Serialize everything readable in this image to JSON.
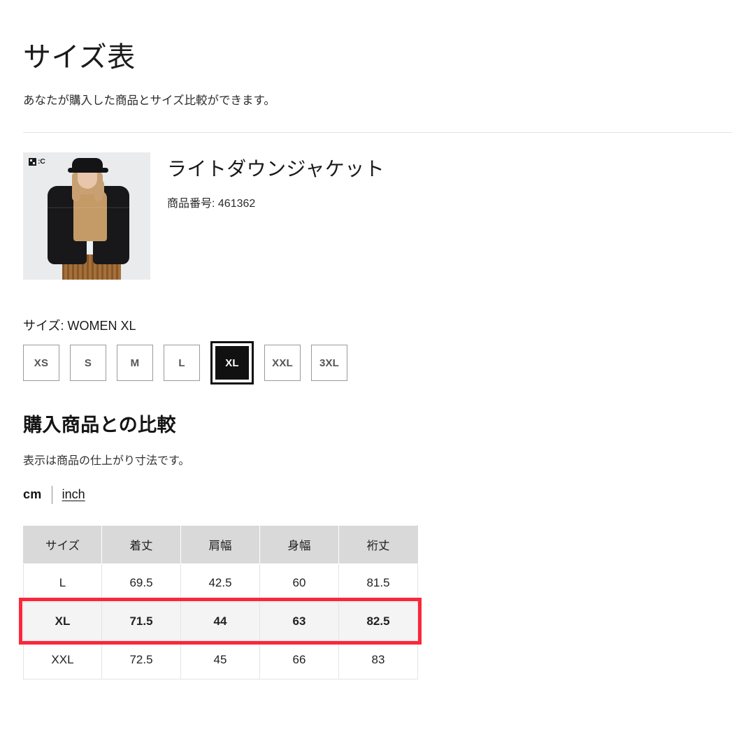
{
  "header": {
    "title": "サイズ表",
    "subtitle": "あなたが購入した商品とサイズ比較ができます。"
  },
  "product": {
    "badge_text": ":C",
    "name": "ライトダウンジャケット",
    "code_label": "商品番号: 461362"
  },
  "size_selector": {
    "label": "サイズ: WOMEN XL",
    "selected": "XL",
    "options": [
      {
        "label": "XS",
        "selected": false
      },
      {
        "label": "S",
        "selected": false
      },
      {
        "label": "M",
        "selected": false
      },
      {
        "label": "L",
        "selected": false
      },
      {
        "label": "XL",
        "selected": true
      },
      {
        "label": "XXL",
        "selected": false
      },
      {
        "label": "3XL",
        "selected": false
      }
    ]
  },
  "comparison": {
    "title": "購入商品との比較",
    "note": "表示は商品の仕上がり寸法です。",
    "units": {
      "active": "cm",
      "inactive": "inch"
    }
  },
  "table": {
    "columns": [
      "サイズ",
      "着丈",
      "肩幅",
      "身幅",
      "裄丈"
    ],
    "rows": [
      {
        "size": "L",
        "values": [
          "69.5",
          "42.5",
          "60",
          "81.5"
        ],
        "highlighted": false
      },
      {
        "size": "XL",
        "values": [
          "71.5",
          "44",
          "63",
          "82.5"
        ],
        "highlighted": true
      },
      {
        "size": "XXL",
        "values": [
          "72.5",
          "45",
          "66",
          "83"
        ],
        "highlighted": false
      }
    ]
  },
  "colors": {
    "highlight_red": "#f9283c",
    "header_gray": "#d9d9d9",
    "highlight_row_bg": "#f4f4f4",
    "accent_black": "#111111"
  }
}
